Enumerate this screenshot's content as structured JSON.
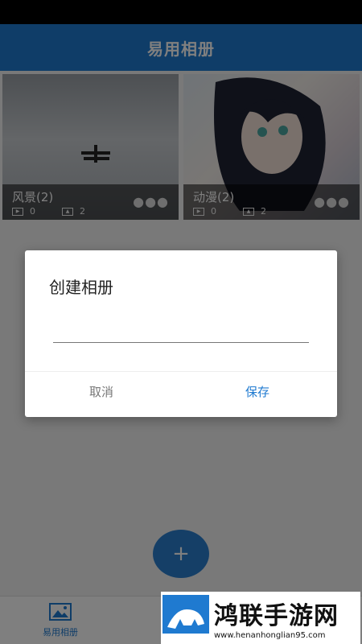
{
  "app_bar": {
    "title": "易用相册"
  },
  "albums": [
    {
      "name": "风景(2)",
      "videos": "0",
      "photos": "2"
    },
    {
      "name": "动漫(2)",
      "videos": "0",
      "photos": "2"
    }
  ],
  "dialog": {
    "title": "创建相册",
    "input_value": "",
    "cancel_label": "取消",
    "save_label": "保存"
  },
  "fab": {
    "label": "+"
  },
  "bottom_nav": {
    "item_label": "易用相册"
  },
  "watermark": {
    "title": "鸿联手游网",
    "url": "www.henanhonglian95.com"
  },
  "colors": {
    "primary": "#1f7ad0",
    "overlay": "rgba(0,0,0,0.5)"
  }
}
